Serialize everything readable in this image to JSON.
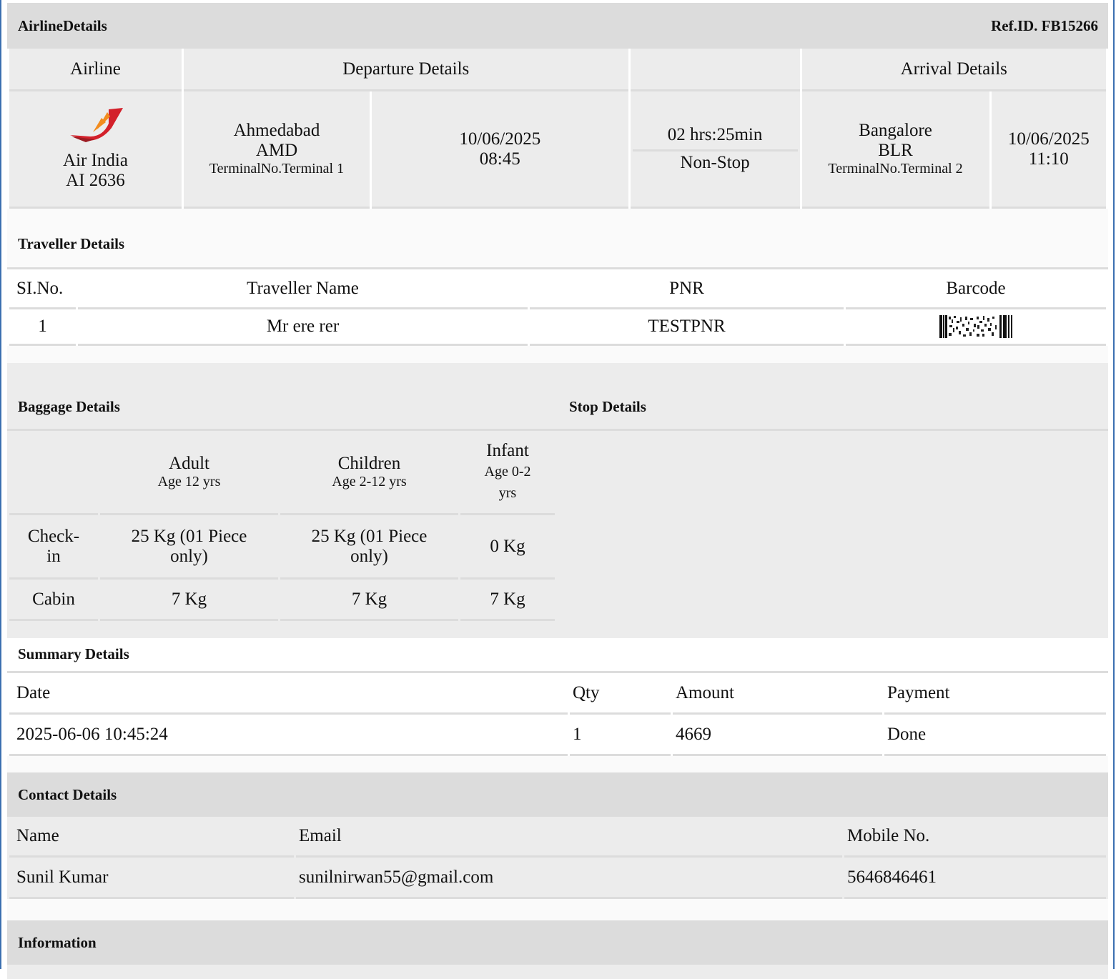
{
  "airline_details": {
    "title": "AirlineDetails",
    "ref_id": "Ref.ID. FB15266",
    "headers": {
      "airline": "Airline",
      "departure": "Departure Details",
      "arrival": "Arrival Details"
    },
    "flight": {
      "airline_name": "Air India",
      "flight_no": "AI 2636",
      "dep_city": "Ahmedabad",
      "dep_code": "AMD",
      "dep_terminal": "TerminalNo.Terminal 1",
      "dep_date": "10/06/2025",
      "dep_time": "08:45",
      "duration": "02 hrs:25min",
      "stops": "Non-Stop",
      "arr_city": "Bangalore",
      "arr_code": "BLR",
      "arr_terminal": "TerminalNo.Terminal 2",
      "arr_date": "10/06/2025",
      "arr_time": "11:10"
    }
  },
  "traveller_details": {
    "title": "Traveller Details",
    "headers": {
      "sl": "SI.No.",
      "name": "Traveller Name",
      "pnr": "PNR",
      "barcode": "Barcode"
    },
    "rows": [
      {
        "sl": "1",
        "name": "Mr ere rer",
        "pnr": "TESTPNR"
      }
    ]
  },
  "baggage_details": {
    "title": "Baggage Details",
    "stop_title": "Stop Details",
    "headers": {
      "adult": "Adult",
      "adult_age": "Age 12 yrs",
      "children": "Children",
      "children_age": "Age 2-12 yrs",
      "infant": "Infant",
      "infant_age": "Age 0-2 yrs"
    },
    "rows": {
      "checkin": {
        "label": "Check-in",
        "adult": "25 Kg (01 Piece only)",
        "children": "25 Kg (01 Piece only)",
        "infant": "0 Kg"
      },
      "cabin": {
        "label": "Cabin",
        "adult": "7 Kg",
        "children": "7 Kg",
        "infant": "7 Kg"
      }
    }
  },
  "summary_details": {
    "title": "Summary Details",
    "headers": {
      "date": "Date",
      "qty": "Qty",
      "amount": "Amount",
      "payment": "Payment"
    },
    "row": {
      "date": "2025-06-06 10:45:24",
      "qty": "1",
      "amount": "4669",
      "payment": "Done"
    }
  },
  "contact_details": {
    "title": "Contact Details",
    "headers": {
      "name": "Name",
      "email": "Email",
      "mobile": "Mobile No."
    },
    "row": {
      "name": "Sunil Kumar",
      "email": "sunilnirwan55@gmail.com",
      "mobile": "5646846461"
    }
  },
  "information": {
    "title": "Information"
  },
  "colors": {
    "header_bg": "#dcdcdc",
    "cell_bg": "#ececec",
    "frame": "#3b6fb0",
    "logo_red": "#d3202a",
    "logo_orange": "#f28c1e"
  },
  "icons": {
    "airline_logo": "air-india-logo-icon",
    "barcode": "barcode-icon"
  }
}
